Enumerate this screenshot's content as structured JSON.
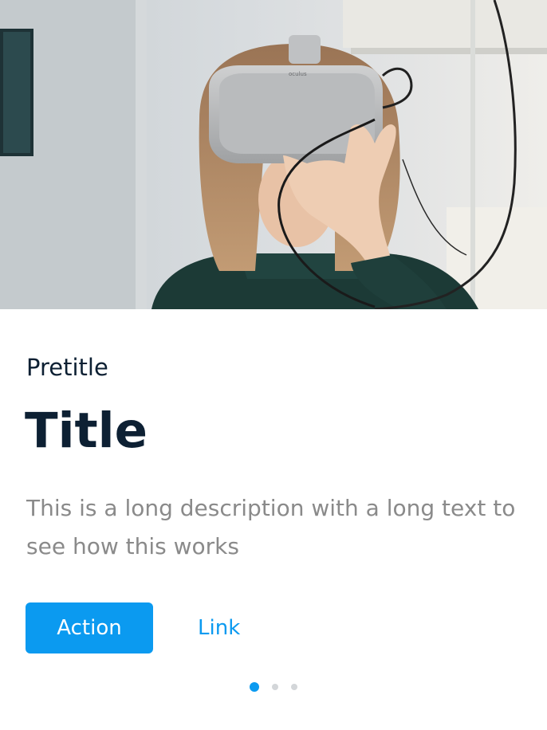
{
  "card": {
    "image": {
      "icon": "vr-headset-photo",
      "headset_brand": "oculus"
    },
    "pretitle": "Pretitle",
    "title": "Title",
    "description": "This is a long description with a long text to see how this works",
    "primary_action": "Action",
    "secondary_action": "Link"
  },
  "pagination": {
    "total": 3,
    "active_index": 0
  },
  "colors": {
    "accent": "#0b9af0",
    "title": "#0d2033",
    "description": "#8a8a8a",
    "inactive_dot": "#d3d6d9"
  }
}
